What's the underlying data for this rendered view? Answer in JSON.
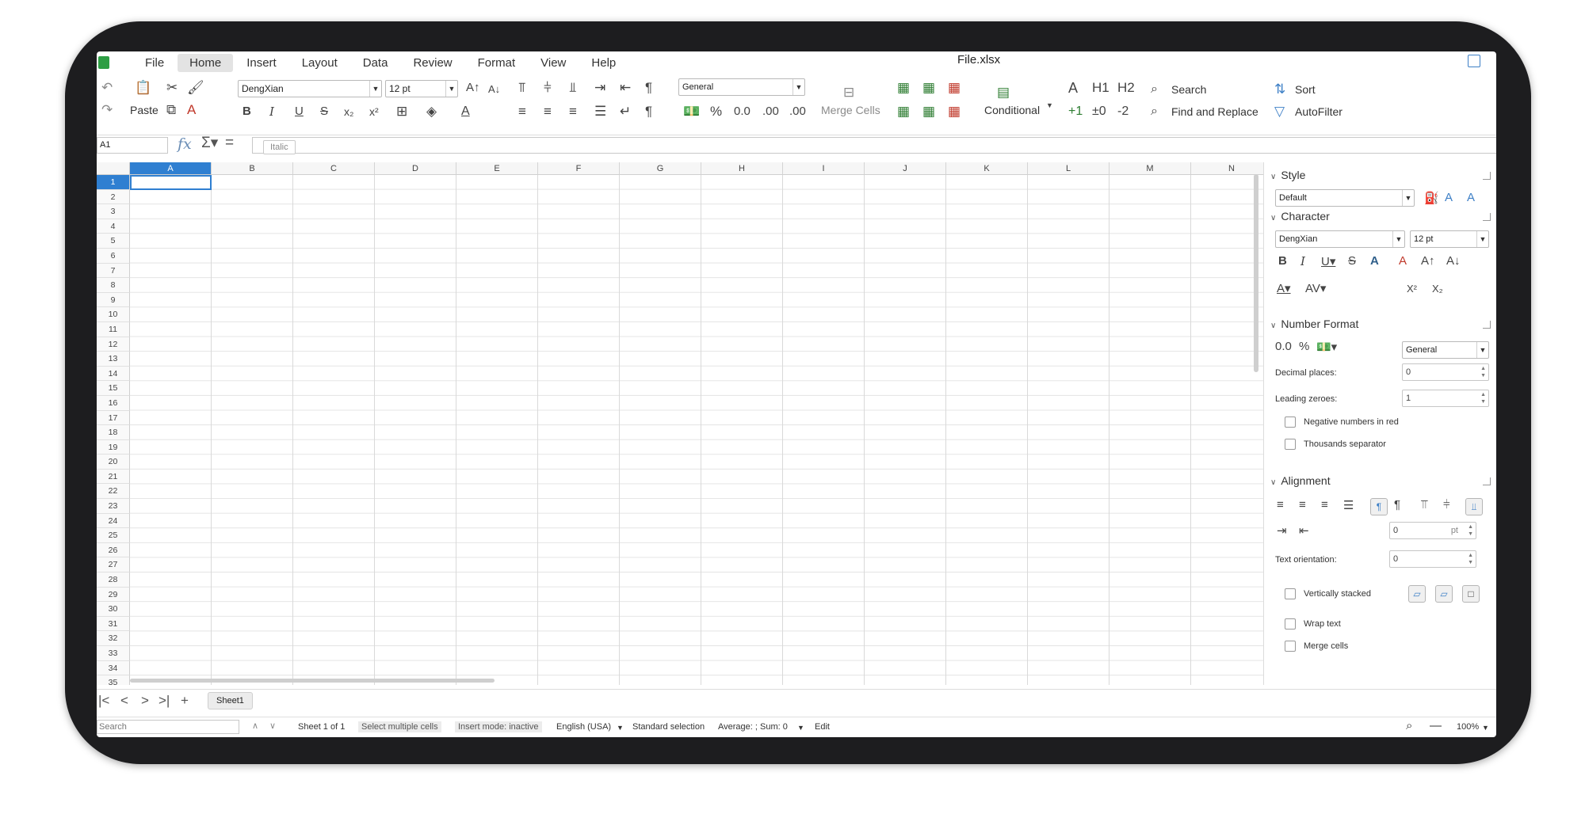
{
  "app": {
    "doc_title": "File.xlsx"
  },
  "menu": [
    "File",
    "Home",
    "Insert",
    "Layout",
    "Data",
    "Review",
    "Format",
    "View",
    "Help"
  ],
  "ribbon": {
    "paste_label": "Paste",
    "font_name": "DengXian",
    "font_size": "12 pt",
    "number_format": "General",
    "merge_cells_label": "Merge Cells",
    "conditional_label": "Conditional",
    "search_label": "Search",
    "find_replace_label": "Find and Replace",
    "sort_label": "Sort",
    "autofilter_label": "AutoFilter",
    "h1": "H1",
    "h2": "H2",
    "plus_one": "+1",
    "pm_zero": "±0",
    "minus_two": "-2",
    "percent": "%",
    "decimal": "0.0",
    "decimal_add": ".00",
    "decimal_del": ".00"
  },
  "formula_bar": {
    "name_box": "A1",
    "tooltip": "Italic"
  },
  "grid": {
    "columns": [
      "A",
      "B",
      "C",
      "D",
      "E",
      "F",
      "G",
      "H",
      "I",
      "J",
      "K",
      "L",
      "M",
      "N"
    ],
    "rows": [
      "1",
      "2",
      "3",
      "4",
      "5",
      "6",
      "7",
      "8",
      "9",
      "10",
      "11",
      "12",
      "13",
      "14",
      "15",
      "16",
      "17",
      "18",
      "19",
      "20",
      "21",
      "22",
      "23",
      "24",
      "25",
      "26",
      "27",
      "28",
      "29",
      "30",
      "31",
      "32",
      "33",
      "34",
      "35"
    ],
    "selected_cell": "A1"
  },
  "sidebar": {
    "style_title": "Style",
    "style_value": "Default",
    "character_title": "Character",
    "char_font": "DengXian",
    "char_size": "12 pt",
    "number_format_title": "Number Format",
    "number_format_value": "General",
    "decimal_places_label": "Decimal places:",
    "decimal_places_value": "0",
    "leading_zeroes_label": "Leading zeroes:",
    "leading_zeroes_value": "1",
    "negative_red_label": "Negative numbers in red",
    "thousands_sep_label": "Thousands separator",
    "alignment_title": "Alignment",
    "indent_value": "0",
    "indent_unit": "pt",
    "text_orientation_label": "Text orientation:",
    "text_orientation_value": "0",
    "vertically_stacked_label": "Vertically stacked",
    "wrap_text_label": "Wrap text",
    "merge_cells_label": "Merge cells"
  },
  "sheet_tabs": [
    "Sheet1"
  ],
  "status": {
    "search_placeholder": "Search",
    "sheet_of": "Sheet 1 of 1",
    "select_multiple": "Select multiple cells",
    "insert_mode": "Insert mode: inactive",
    "language": "English (USA)",
    "selection_mode": "Standard selection",
    "sum": "Average: ; Sum: 0",
    "edit": "Edit",
    "zoom": "100%"
  }
}
